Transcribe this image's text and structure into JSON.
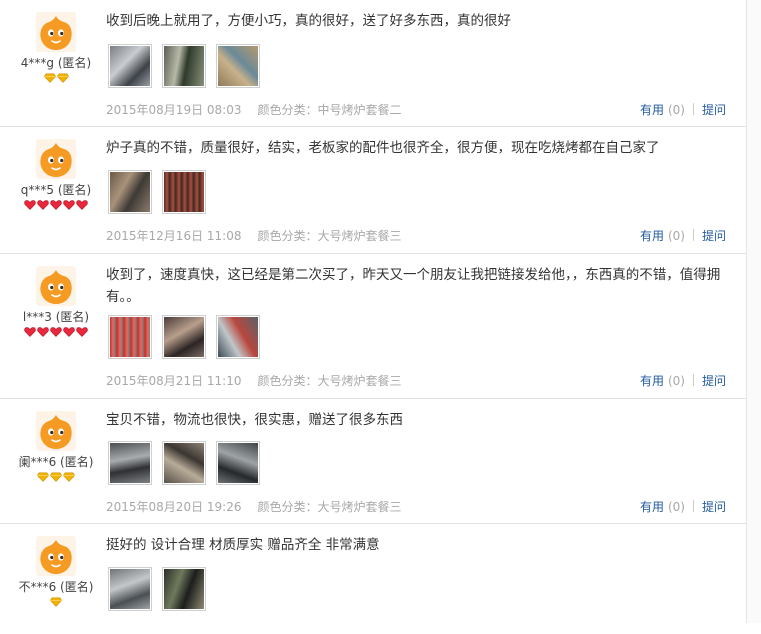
{
  "reviews": [
    {
      "user": "4***g (匿名)",
      "badge_type": "diamond",
      "badge_count": 2,
      "badge_color": "#f2b300",
      "text": "收到后晚上就用了，方便小巧，真的很好，送了好多东西，真的很好",
      "photos": [
        "photo-grill-box",
        "photo-skewers",
        "photo-accessories"
      ],
      "date": "2015年08月19日 08:03",
      "category": "颜色分类：中号烤炉套餐二",
      "useful_label": "有用",
      "useful_count": "(0)",
      "ask_label": "提问"
    },
    {
      "user": "q***5 (匿名)",
      "badge_type": "heart",
      "badge_count": 5,
      "badge_color": "#e8283c",
      "text": "炉子真的不错，质量很好，结实，老板家的配件也很齐全，很方便，现在吃烧烤都在自己家了",
      "photos": [
        "photo-grill-closeup",
        "photo-meat-skewers"
      ],
      "date": "2015年12月16日 11:08",
      "category": "颜色分类：大号烤炉套餐三",
      "useful_label": "有用",
      "useful_count": "(0)",
      "ask_label": "提问"
    },
    {
      "user": "l***3 (匿名)",
      "badge_type": "heart",
      "badge_count": 5,
      "badge_color": "#e8283c",
      "text": "收到了，速度真快，这已经是第二次买了，昨天又一个朋友让我把链接发给他，，东西真的不错，值得拥有。。",
      "photos": [
        "photo-red-skewers",
        "photo-package",
        "photo-grilling"
      ],
      "date": "2015年08月21日 11:10",
      "category": "颜色分类：大号烤炉套餐三",
      "useful_label": "有用",
      "useful_count": "(0)",
      "ask_label": "提问"
    },
    {
      "user": "阑***6 (匿名)",
      "badge_type": "diamond",
      "badge_count": 3,
      "badge_color": "#f2b300",
      "text": "宝贝不错，物流也很快，很实惠，赠送了很多东西",
      "photos": [
        "photo-grill-top",
        "photo-grill-parts",
        "photo-grill-side"
      ],
      "date": "2015年08月20日 19:26",
      "category": "颜色分类：大号烤炉套餐三",
      "useful_label": "有用",
      "useful_count": "(0)",
      "ask_label": "提问"
    },
    {
      "user": "不***6 (匿名)",
      "badge_type": "diamond",
      "badge_count": 1,
      "badge_color": "#f2b300",
      "text": "挺好的 设计合理 材质厚实 赠品齐全 非常满意",
      "photos": [
        "photo-steel-tray",
        "photo-night-grill"
      ],
      "date": "",
      "category": "",
      "useful_label": "",
      "useful_count": "",
      "ask_label": ""
    }
  ],
  "colors": {
    "link": "#225aa0",
    "meta": "#a8a8a8",
    "avatar_orange": "#f59a23",
    "divider": "#e3e3e3"
  }
}
